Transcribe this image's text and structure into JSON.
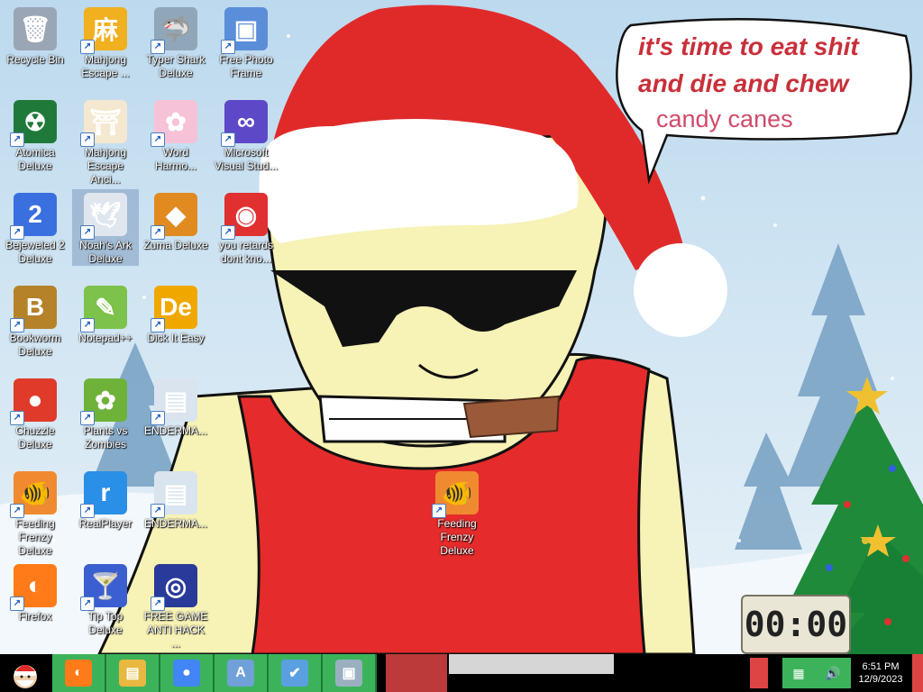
{
  "desktop": {
    "icons": [
      {
        "label": "Recycle Bin",
        "icon": "recycle-bin-icon",
        "color": "#9aa6b5",
        "glyph": "🗑"
      },
      {
        "label": "Mahjong Escape ...",
        "icon": "mahjong-icon",
        "color": "#f0b020",
        "glyph": "麻"
      },
      {
        "label": "Typer Shark Deluxe",
        "icon": "shark-icon",
        "color": "#8fa7b8",
        "glyph": "🦈"
      },
      {
        "label": "Free Photo Frame",
        "icon": "photo-frame-icon",
        "color": "#5b8ed8",
        "glyph": "▣"
      },
      {
        "label": "Atomica Deluxe",
        "icon": "atomica-icon",
        "color": "#1f7a3a",
        "glyph": "☢"
      },
      {
        "label": "Mahjong Escape Anci...",
        "icon": "torii-icon",
        "color": "#f4e8d0",
        "glyph": "⛩"
      },
      {
        "label": "Word Harmo...",
        "icon": "flower-icon",
        "color": "#f6c2d8",
        "glyph": "✿"
      },
      {
        "label": "Microsoft Visual Stud...",
        "icon": "visual-studio-icon",
        "color": "#5d49c8",
        "glyph": "∞"
      },
      {
        "label": "Bejeweled 2 Deluxe",
        "icon": "gem-icon",
        "color": "#3a6fe0",
        "glyph": "2"
      },
      {
        "label": "Noah's Ark Deluxe",
        "icon": "dove-icon",
        "color": "#dfe6ee",
        "glyph": "🕊"
      },
      {
        "label": "Zuma Deluxe",
        "icon": "zuma-icon",
        "color": "#e08a20",
        "glyph": "◆"
      },
      {
        "label": "you retards dont kno...",
        "icon": "dragon-icon",
        "color": "#e03030",
        "glyph": "◉"
      },
      {
        "label": "Bookworm Deluxe",
        "icon": "bookworm-icon",
        "color": "#b5822a",
        "glyph": "B"
      },
      {
        "label": "Notepad++",
        "icon": "notepad-icon",
        "color": "#7cc24b",
        "glyph": "✎"
      },
      {
        "label": "Dick It Easy",
        "icon": "de-icon",
        "color": "#f0a800",
        "glyph": "De"
      },
      {
        "label": "Chuzzle Deluxe",
        "icon": "chuzzle-icon",
        "color": "#e03b2a",
        "glyph": "●"
      },
      {
        "label": "Plants vs Zombies",
        "icon": "plant-icon",
        "color": "#6fb23a",
        "glyph": "✿"
      },
      {
        "label": "ENDERMA...",
        "icon": "document-icon",
        "color": "#d9e4ee",
        "glyph": "▤"
      },
      {
        "label": "Feeding Frenzy Deluxe",
        "icon": "fish-icon",
        "color": "#f08a30",
        "glyph": "🐠"
      },
      {
        "label": "RealPlayer",
        "icon": "realplayer-icon",
        "color": "#2a8fe6",
        "glyph": "r"
      },
      {
        "label": "ENDERMA...",
        "icon": "document-icon",
        "color": "#d9e4ee",
        "glyph": "▤"
      },
      {
        "label": "Firefox",
        "icon": "firefox-icon",
        "color": "#ff7a18",
        "glyph": "◐"
      },
      {
        "label": "Tip Top Deluxe",
        "icon": "cocktail-icon",
        "color": "#3b5fd0",
        "glyph": "🍸"
      },
      {
        "label": "FREE GAME ANTI HACK ...",
        "icon": "shield-icon",
        "color": "#2a3a9a",
        "glyph": "◎"
      },
      {
        "label": "Feeding Frenzy Deluxe",
        "icon": "fish-icon",
        "color": "#f08a30",
        "glyph": "🐠"
      }
    ]
  },
  "speech_bubble": {
    "line1": "it's time to eat shit",
    "line2": "and die and chew",
    "line3": "candy canes"
  },
  "clock_widget": {
    "display": "00:00"
  },
  "taskbar": {
    "start": "start-santa-icon",
    "apps": [
      {
        "name": "firefox",
        "glyph": "◐",
        "color": "#ff7a18"
      },
      {
        "name": "file-explorer",
        "glyph": "▤",
        "color": "#e8b840"
      },
      {
        "name": "chrome",
        "glyph": "●",
        "color": "#4285f4"
      },
      {
        "name": "wordpad",
        "glyph": "A",
        "color": "#6fa0d8"
      },
      {
        "name": "checkbox-app",
        "glyph": "✔",
        "color": "#5aa0e0"
      },
      {
        "name": "computer",
        "glyph": "▣",
        "color": "#9ab0c0"
      }
    ],
    "tray": {
      "time": "6:51 PM",
      "date": "12/9/2023"
    }
  },
  "colors": {
    "hat_red": "#e02a2a",
    "shirt_red": "#e52b2b",
    "skin": "#f7f2b5",
    "taskbar_green": "#3cb35a"
  }
}
